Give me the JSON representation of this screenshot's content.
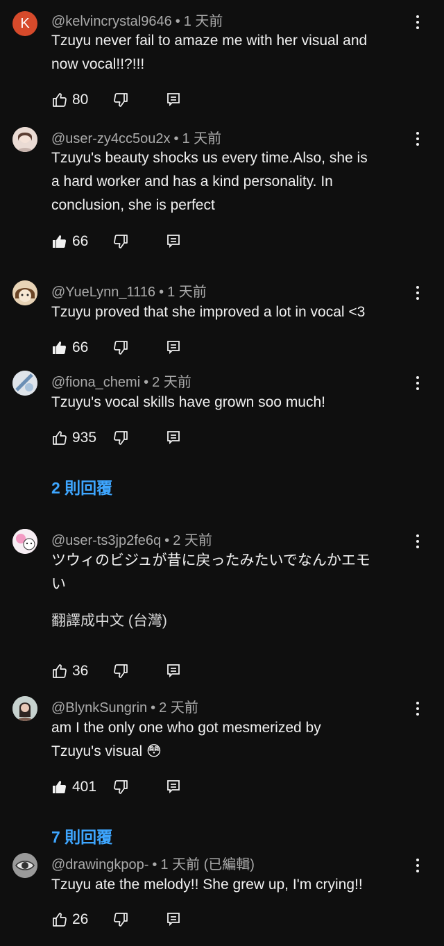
{
  "colors": {
    "background": "#0f0f0f",
    "accent": "#3ea6ff",
    "meta": "#aaaaaa"
  },
  "comments": [
    {
      "username": "@kelvincrystal9646",
      "time": "1 天前",
      "avatar_letter": "K",
      "lines": [
        "Tzuyu never fail to amaze me with her visual and",
        "now vocal!!?!!!"
      ],
      "likes": "80",
      "liked": false
    },
    {
      "username": "@user-zy4cc5ou2x",
      "time": "1 天前",
      "lines": [
        "Tzuyu's beauty shocks us every time.Also, she is",
        "a hard worker and has a kind personality. In",
        "conclusion, she is perfect"
      ],
      "likes": "66",
      "liked": true
    },
    {
      "username": "@YueLynn_1116",
      "time": "1 天前",
      "lines": [
        "Tzuyu proved that she improved a lot in vocal <3"
      ],
      "likes": "66",
      "liked": true
    },
    {
      "username": "@fiona_chemi",
      "time": "2 天前",
      "lines": [
        "Tzuyu's vocal skills have grown soo much!"
      ],
      "likes": "935",
      "liked": false,
      "replies_label": "2 則回覆"
    },
    {
      "username": "@user-ts3jp2fe6q",
      "time": "2 天前",
      "lines": [
        "ツウィのビジュが昔に戻ったみたいでなんかエモ",
        "い"
      ],
      "translate_label": "翻譯成中文 (台灣)",
      "likes": "36",
      "liked": false
    },
    {
      "username": "@BlynkSungrin",
      "time": "2 天前",
      "lines": [
        "am I the only one who got mesmerized by",
        "Tzuyu's visual 😳"
      ],
      "likes": "401",
      "liked": true,
      "replies_label": "7 則回覆"
    },
    {
      "username": "@drawingkpop-",
      "time": "1 天前 (已編輯)",
      "lines": [
        "Tzuyu ate the melody!! She grew up, I'm crying!!"
      ],
      "likes": "26",
      "liked": false
    }
  ]
}
